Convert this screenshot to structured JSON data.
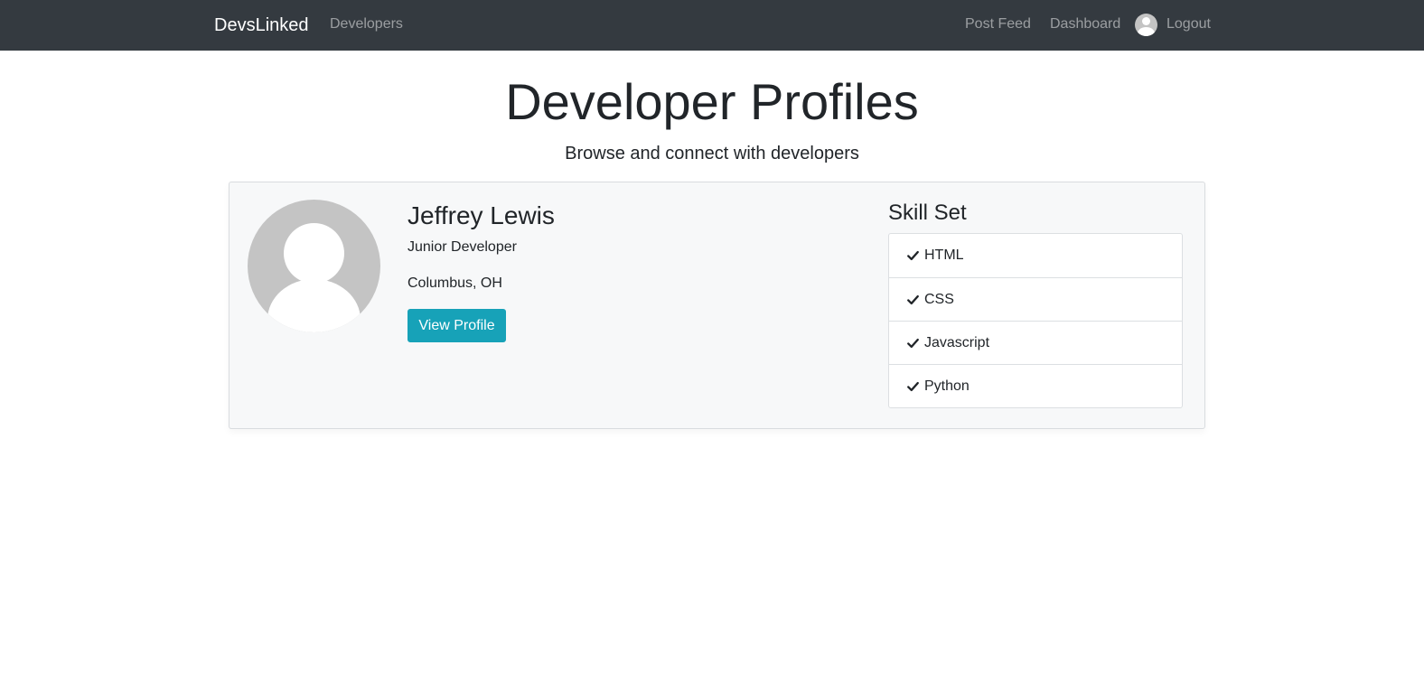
{
  "nav": {
    "brand": "DevsLinked",
    "developers": "Developers",
    "post_feed": "Post Feed",
    "dashboard": "Dashboard",
    "logout": "Logout"
  },
  "page": {
    "title": "Developer Profiles",
    "lead": "Browse and connect with developers"
  },
  "profile": {
    "name": "Jeffrey Lewis",
    "role": "Junior Developer",
    "location": "Columbus, OH",
    "button": "View Profile",
    "skills_title": "Skill Set",
    "skills": [
      "HTML",
      "CSS",
      "Javascript",
      "Python"
    ]
  },
  "colors": {
    "navbar": "#343a40",
    "button": "#17a2b8",
    "card_bg": "#f7f8f9"
  },
  "icons": [
    "user-avatar-icon",
    "check-icon"
  ]
}
